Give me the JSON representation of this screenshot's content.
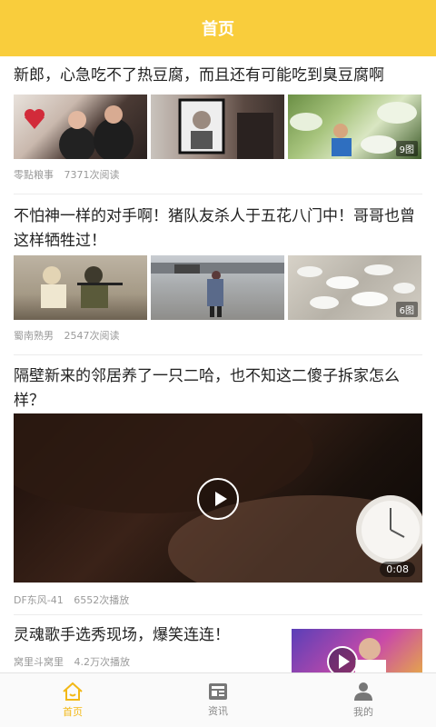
{
  "header": {
    "title": "首页"
  },
  "articles": [
    {
      "title": "新郎，心急吃不了热豆腐，而且还有可能吃到臭豆腐啊",
      "source": "零點粮事",
      "stats": "7371次阅读",
      "image_count": "9图"
    },
    {
      "title": "不怕神一样的对手啊！猪队友杀人于五花八门中！哥哥也曾这样牺牲过！",
      "source": "蜀南熟男",
      "stats": "2547次阅读",
      "image_count": "6图"
    },
    {
      "title": "隔壁新来的邻居养了一只二哈，也不知这二傻子拆家怎么样？",
      "source": "DF东风-41",
      "stats": "6552次播放",
      "duration": "0:08"
    },
    {
      "title": "灵魂歌手选秀现场，爆笑连连！",
      "source": "窝里斗窝里",
      "stats": "4.2万次播放"
    }
  ],
  "tabs": [
    {
      "label": "首页",
      "icon": "home-icon",
      "active": true
    },
    {
      "label": "资讯",
      "icon": "news-icon",
      "active": false
    },
    {
      "label": "我的",
      "icon": "profile-icon",
      "active": false
    }
  ],
  "colors": {
    "accent": "#f9cd3c",
    "active_tab": "#f2b816",
    "meta_text": "#9a9a9a"
  }
}
